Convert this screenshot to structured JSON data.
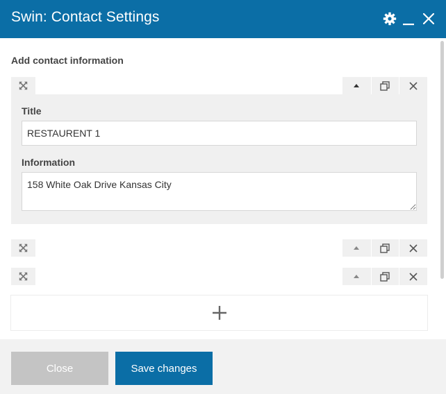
{
  "window": {
    "title": "Swin: Contact Settings",
    "accent_color": "#0b6ea6",
    "header_icons": [
      "gear-icon",
      "minimize-icon",
      "close-icon"
    ]
  },
  "section": {
    "label": "Add contact information"
  },
  "items": [
    {
      "expanded": true,
      "title_label": "Title",
      "title_value": "RESTAURENT 1",
      "info_label": "Information",
      "info_value": "158 White Oak Drive Kansas City"
    },
    {
      "expanded": false
    },
    {
      "expanded": false
    }
  ],
  "row_controls": [
    "move-up-icon",
    "duplicate-icon",
    "remove-icon"
  ],
  "add_item_icon": "plus-icon",
  "footer": {
    "close_label": "Close",
    "save_label": "Save changes"
  }
}
